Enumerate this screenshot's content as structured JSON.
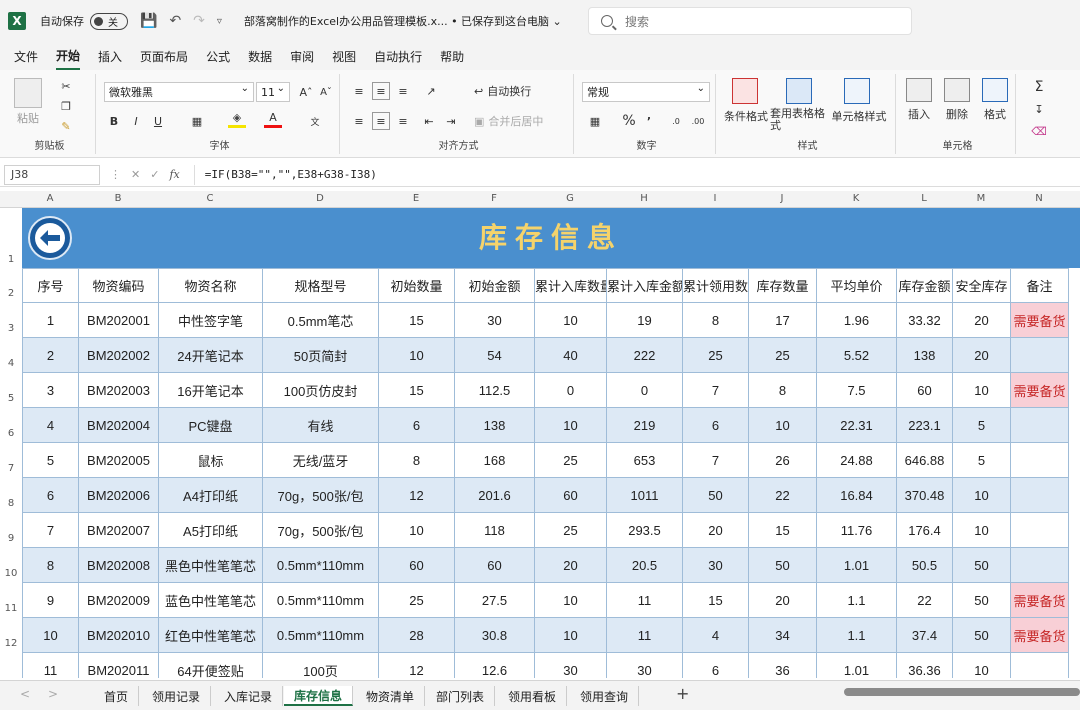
{
  "titlebar": {
    "autosave_label": "自动保存",
    "autosave_state": "关",
    "filename": "部落窝制作的Excel办公用品管理模板.x... • 已保存到这台电脑 ⌄",
    "search_placeholder": "搜索"
  },
  "menu": [
    "文件",
    "开始",
    "插入",
    "页面布局",
    "公式",
    "数据",
    "审阅",
    "视图",
    "自动执行",
    "帮助"
  ],
  "ribbon": {
    "paste": "粘贴",
    "clipboard": "剪贴板",
    "font_name": "微软雅黑",
    "font_size": "11",
    "font_group": "字体",
    "wrap_text": "自动换行",
    "merge_center": "合并后居中",
    "alignment_group": "对齐方式",
    "number_format": "常规",
    "number_group": "数字",
    "cond_format": "条件格式",
    "table_format": "套用表格格式",
    "cell_style": "单元格样式",
    "style_group": "样式",
    "insert": "插入",
    "delete": "删除",
    "format": "格式",
    "cells_group": "单元格",
    "bold": "B",
    "italic": "I",
    "underline": "U"
  },
  "formula_bar": {
    "cell_ref": "J38",
    "formula": "=IF(B38=\"\",\"\",E38+G38-I38)"
  },
  "columns": [
    "A",
    "B",
    "C",
    "D",
    "E",
    "F",
    "G",
    "H",
    "I",
    "J",
    "K",
    "L",
    "M",
    "N"
  ],
  "rows": [
    "1",
    "2",
    "3",
    "4",
    "5",
    "6",
    "7",
    "8",
    "9",
    "10",
    "11",
    "12"
  ],
  "sheet": {
    "title": "库存信息",
    "headers": [
      "序号",
      "物资编码",
      "物资名称",
      "规格型号",
      "初始数量",
      "初始金额",
      "累计入库数量",
      "累计入库金额",
      "累计领用数量",
      "库存数量",
      "平均单价",
      "库存金额",
      "安全库存",
      "备注"
    ],
    "data": [
      [
        "1",
        "BM202001",
        "中性签字笔",
        "0.5mm笔芯",
        "15",
        "30",
        "10",
        "19",
        "8",
        "17",
        "1.96",
        "33.32",
        "20",
        "需要备货"
      ],
      [
        "2",
        "BM202002",
        "24开笔记本",
        "50页简封",
        "10",
        "54",
        "40",
        "222",
        "25",
        "25",
        "5.52",
        "138",
        "20",
        ""
      ],
      [
        "3",
        "BM202003",
        "16开笔记本",
        "100页仿皮封",
        "15",
        "112.5",
        "0",
        "0",
        "7",
        "8",
        "7.5",
        "60",
        "10",
        "需要备货"
      ],
      [
        "4",
        "BM202004",
        "PC键盘",
        "有线",
        "6",
        "138",
        "10",
        "219",
        "6",
        "10",
        "22.31",
        "223.1",
        "5",
        ""
      ],
      [
        "5",
        "BM202005",
        "鼠标",
        "无线/蓝牙",
        "8",
        "168",
        "25",
        "653",
        "7",
        "26",
        "24.88",
        "646.88",
        "5",
        ""
      ],
      [
        "6",
        "BM202006",
        "A4打印纸",
        "70g，500张/包",
        "12",
        "201.6",
        "60",
        "1011",
        "50",
        "22",
        "16.84",
        "370.48",
        "10",
        ""
      ],
      [
        "7",
        "BM202007",
        "A5打印纸",
        "70g，500张/包",
        "10",
        "118",
        "25",
        "293.5",
        "20",
        "15",
        "11.76",
        "176.4",
        "10",
        ""
      ],
      [
        "8",
        "BM202008",
        "黑色中性笔笔芯",
        "0.5mm*110mm",
        "60",
        "60",
        "20",
        "20.5",
        "30",
        "50",
        "1.01",
        "50.5",
        "50",
        ""
      ],
      [
        "9",
        "BM202009",
        "蓝色中性笔笔芯",
        "0.5mm*110mm",
        "25",
        "27.5",
        "10",
        "11",
        "15",
        "20",
        "1.1",
        "22",
        "50",
        "需要备货"
      ],
      [
        "10",
        "BM202010",
        "红色中性笔笔芯",
        "0.5mm*110mm",
        "28",
        "30.8",
        "10",
        "11",
        "4",
        "34",
        "1.1",
        "37.4",
        "50",
        "需要备货"
      ],
      [
        "11",
        "BM202011",
        "64开便签贴",
        "100页",
        "12",
        "12.6",
        "30",
        "30",
        "6",
        "36",
        "1.01",
        "36.36",
        "10",
        ""
      ]
    ]
  },
  "tabs": [
    "首页",
    "领用记录",
    "入库记录",
    "库存信息",
    "物资清单",
    "部门列表",
    "领用看板",
    "领用查询"
  ],
  "active_tab": "库存信息",
  "colors": {
    "banner": "#4a8fce",
    "title": "#f5d36b",
    "alt_row": "#dde9f5",
    "flag": "#f8cfd6"
  }
}
